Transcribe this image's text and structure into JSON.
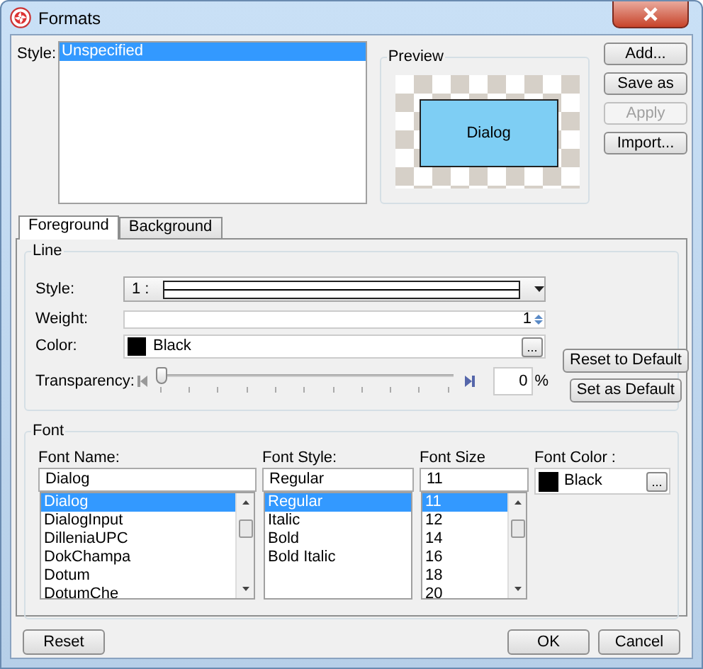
{
  "window": {
    "title": "Formats"
  },
  "style_list": {
    "label": "Style:",
    "items": [
      {
        "text": "Unspecified",
        "selected": true
      }
    ]
  },
  "preview": {
    "title": "Preview",
    "shape_text": "Dialog"
  },
  "side_buttons": [
    {
      "label": "Add...",
      "disabled": false
    },
    {
      "label": "Save as",
      "disabled": false
    },
    {
      "label": "Apply",
      "disabled": true
    },
    {
      "label": "Import...",
      "disabled": false
    }
  ],
  "tabs": [
    {
      "label": "Foreground",
      "selected": true
    },
    {
      "label": "Background",
      "selected": false
    }
  ],
  "line": {
    "title": "Line",
    "style": {
      "label": "Style:",
      "value": "1 :"
    },
    "weight": {
      "label": "Weight:",
      "value": "1"
    },
    "color": {
      "label": "Color:",
      "value": "Black",
      "color": "#000000",
      "browse": "..."
    },
    "transparency": {
      "label": "Transparency:",
      "level": 0,
      "value": "0",
      "unit": "%"
    },
    "buttons": [
      "Reset to Default",
      "Set as Default"
    ]
  },
  "font": {
    "title": "Font",
    "name": {
      "label": "Font Name:",
      "value": "Dialog",
      "items": [
        {
          "text": "Dialog",
          "selected": true
        },
        {
          "text": "DialogInput",
          "selected": false
        },
        {
          "text": "DilleniaUPC",
          "selected": false
        },
        {
          "text": "DokChampa",
          "selected": false
        },
        {
          "text": "Dotum",
          "selected": false
        },
        {
          "text": "DotumChe",
          "selected": false
        }
      ]
    },
    "style": {
      "label": "Font Style:",
      "value": "Regular",
      "items": [
        {
          "text": "Regular",
          "selected": true
        },
        {
          "text": "Italic",
          "selected": false
        },
        {
          "text": "Bold",
          "selected": false
        },
        {
          "text": "Bold Italic",
          "selected": false
        }
      ]
    },
    "size": {
      "label": "Font Size",
      "value": "11",
      "items": [
        {
          "text": "11",
          "selected": true
        },
        {
          "text": "12",
          "selected": false
        },
        {
          "text": "14",
          "selected": false
        },
        {
          "text": "16",
          "selected": false
        },
        {
          "text": "18",
          "selected": false
        },
        {
          "text": "20",
          "selected": false
        }
      ]
    },
    "color": {
      "label": "Font Color :",
      "value": "Black",
      "color": "#000000",
      "browse": "..."
    }
  },
  "bottom_buttons": [
    {
      "label": "Reset",
      "kind": "left"
    },
    {
      "label": "OK",
      "kind": "right"
    },
    {
      "label": "Cancel",
      "kind": "right"
    }
  ]
}
